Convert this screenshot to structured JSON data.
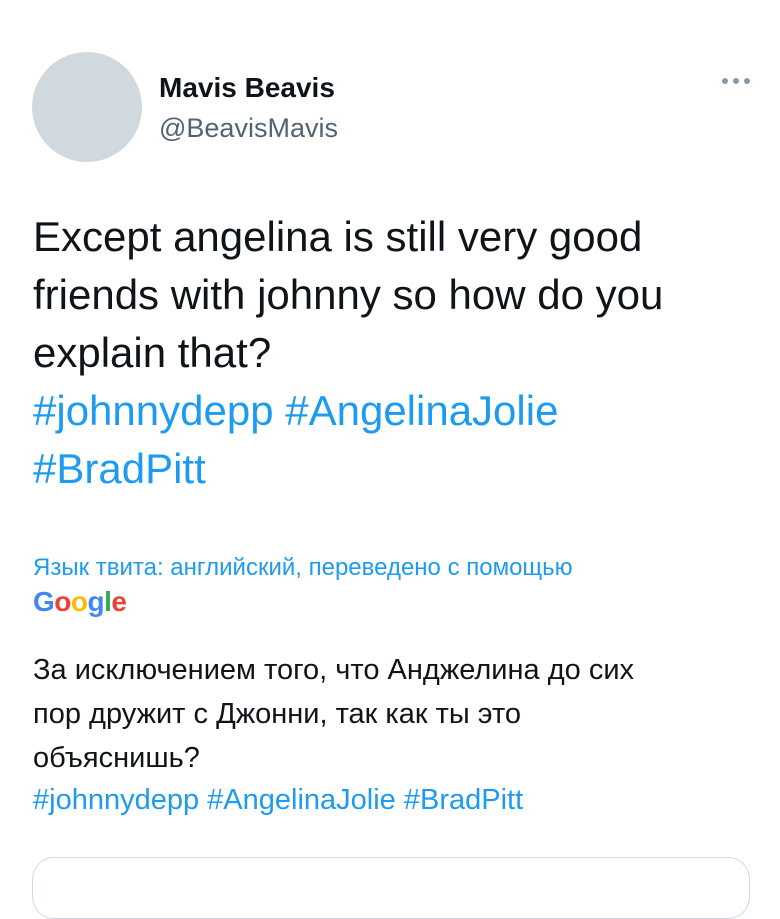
{
  "tweet": {
    "author": {
      "display_name": "Mavis Beavis",
      "handle": "@BeavisMavis",
      "avatar_color": "#cfd9de"
    },
    "more_icon": "more-horizontal-icon",
    "text_lines": [
      "Except angelina is still very good",
      "friends with johnny so how do you",
      "explain that?"
    ],
    "hashtags": [
      "#johnnydepp",
      "#AngelinaJolie",
      "#BradPitt"
    ]
  },
  "translation": {
    "label": "Язык твита: английский, переведено с помощью",
    "provider": {
      "letters": [
        "G",
        "o",
        "o",
        "g",
        "l",
        "e"
      ],
      "colors": [
        "#4285f4",
        "#ea4335",
        "#fbbc05",
        "#4285f4",
        "#34a853",
        "#ea4335"
      ]
    },
    "text_lines": [
      "За исключением того, что Анджелина до сих",
      "пор дружит с Джонни, так как ты это",
      "объяснишь?"
    ],
    "hashtags": [
      "#johnnydepp",
      "#AngelinaJolie",
      "#BradPitt"
    ]
  },
  "colors": {
    "accent": "#1d9bf0",
    "text": "#0f1419",
    "secondary_text": "#536471"
  }
}
